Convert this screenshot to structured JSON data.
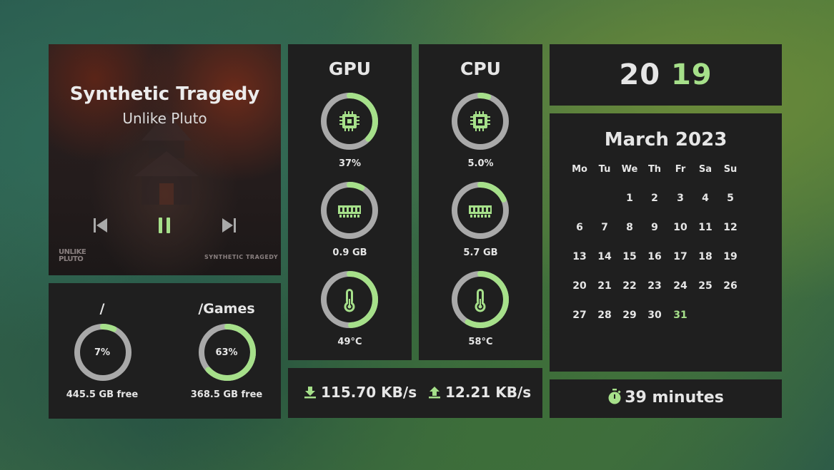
{
  "colors": {
    "accent": "#a6e08a",
    "track": "#a9a9a9",
    "panel": "#1f1f1f",
    "text": "#e6e6e6"
  },
  "music": {
    "title": "Synthetic Tragedy",
    "artist": "Unlike Pluto",
    "cover_text_left": "UNLIKE PLUTO",
    "cover_text_right": "SYNTHETIC TRAGEDY",
    "controls": {
      "previous_icon": "skip-previous-icon",
      "pause_icon": "pause-icon",
      "next_icon": "skip-next-icon"
    }
  },
  "disks": [
    {
      "name": "/",
      "percent_label": "7%",
      "percent": 7,
      "free": "445.5 GB free"
    },
    {
      "name": "/Games",
      "percent_label": "63%",
      "percent": 63,
      "free": "368.5 GB free"
    }
  ],
  "gpu": {
    "name": "GPU",
    "usage": {
      "label": "37%",
      "percent": 37,
      "icon": "chip-icon"
    },
    "memory": {
      "label": "0.9 GB",
      "percent": 8,
      "icon": "ram-icon"
    },
    "temp": {
      "label": "49°C",
      "percent": 49,
      "icon": "thermometer-icon"
    }
  },
  "cpu": {
    "name": "CPU",
    "usage": {
      "label": "5.0%",
      "percent": 5,
      "icon": "chip-icon"
    },
    "memory": {
      "label": "5.7 GB",
      "percent": 18,
      "icon": "ram-icon"
    },
    "temp": {
      "label": "58°C",
      "percent": 58,
      "icon": "thermometer-icon"
    }
  },
  "network": {
    "download": "115.70 KB/s",
    "upload": "12.21 KB/s",
    "download_icon": "download-icon",
    "upload_icon": "upload-icon"
  },
  "year": {
    "first": "20",
    "second": "19"
  },
  "calendar": {
    "month": "March 2023",
    "weekdays": [
      "Mo",
      "Tu",
      "We",
      "Th",
      "Fr",
      "Sa",
      "Su"
    ],
    "first_weekday_index": 2,
    "days_in_month": 31,
    "today": 31
  },
  "timer": {
    "text": "39 minutes",
    "icon": "stopwatch-icon"
  }
}
